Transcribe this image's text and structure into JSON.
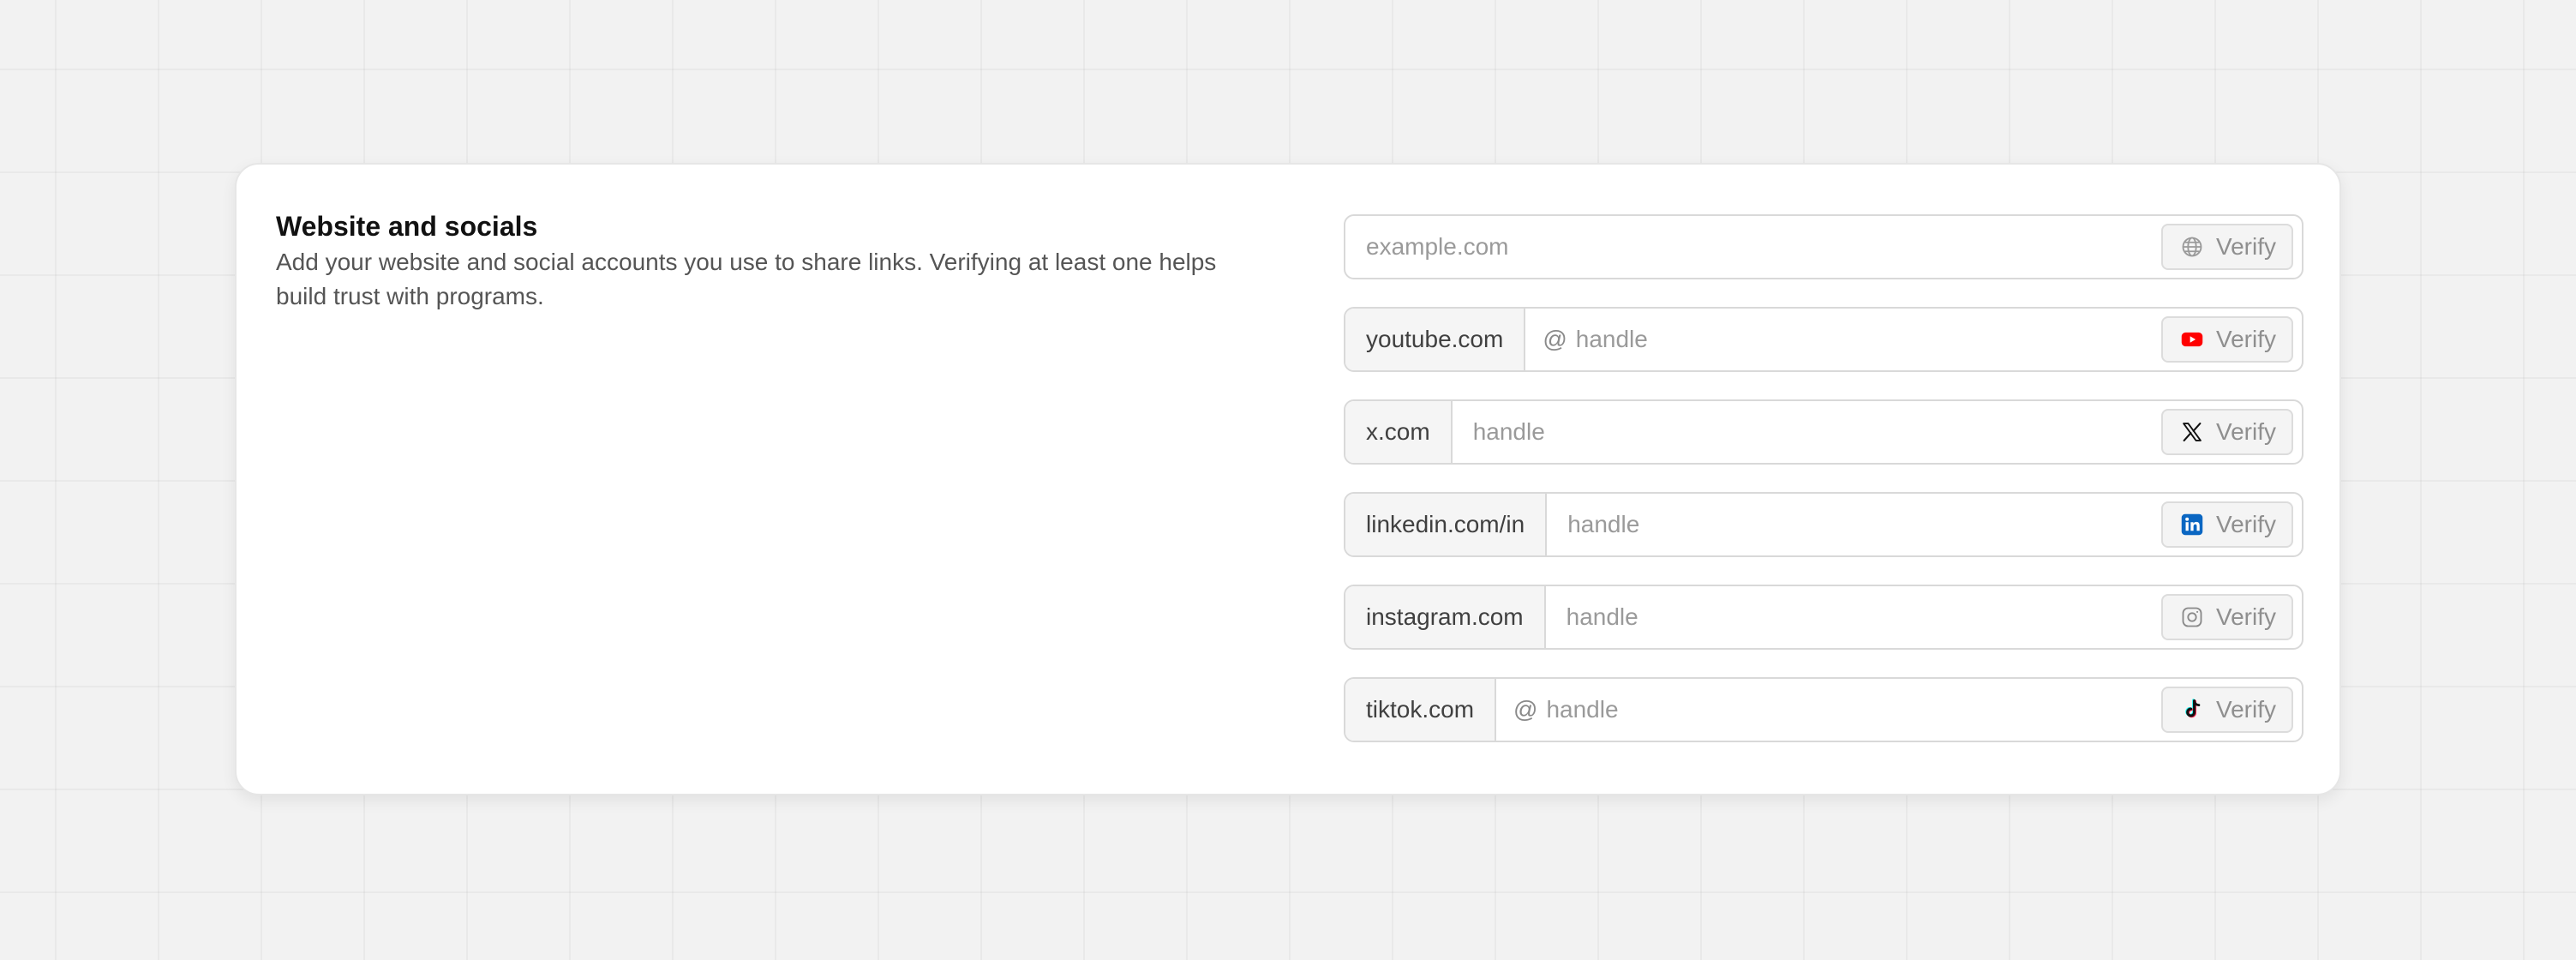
{
  "section": {
    "title": "Website and socials",
    "description": "Add your website and social accounts you use to share links. Verifying at least one helps build trust with programs."
  },
  "fields": [
    {
      "id": "website",
      "prefix": "",
      "at": "",
      "placeholder": "example.com",
      "value": "",
      "verify_label": "Verify",
      "icon": "globe-icon"
    },
    {
      "id": "youtube",
      "prefix": "youtube.com",
      "at": "@",
      "placeholder": "handle",
      "value": "",
      "verify_label": "Verify",
      "icon": "youtube-icon",
      "icon_color": "#ff0000"
    },
    {
      "id": "x",
      "prefix": "x.com",
      "at": "",
      "placeholder": "handle",
      "value": "",
      "verify_label": "Verify",
      "icon": "x-icon",
      "icon_color": "#000000"
    },
    {
      "id": "linkedin",
      "prefix": "linkedin.com/in",
      "at": "",
      "placeholder": "handle",
      "value": "",
      "verify_label": "Verify",
      "icon": "linkedin-icon",
      "icon_color": "#0a66c2"
    },
    {
      "id": "instagram",
      "prefix": "instagram.com",
      "at": "",
      "placeholder": "handle",
      "value": "",
      "verify_label": "Verify",
      "icon": "instagram-icon",
      "icon_color": "#8a8a8a"
    },
    {
      "id": "tiktok",
      "prefix": "tiktok.com",
      "at": "@",
      "placeholder": "handle",
      "value": "",
      "verify_label": "Verify",
      "icon": "tiktok-icon",
      "icon_color": "#000000"
    }
  ]
}
